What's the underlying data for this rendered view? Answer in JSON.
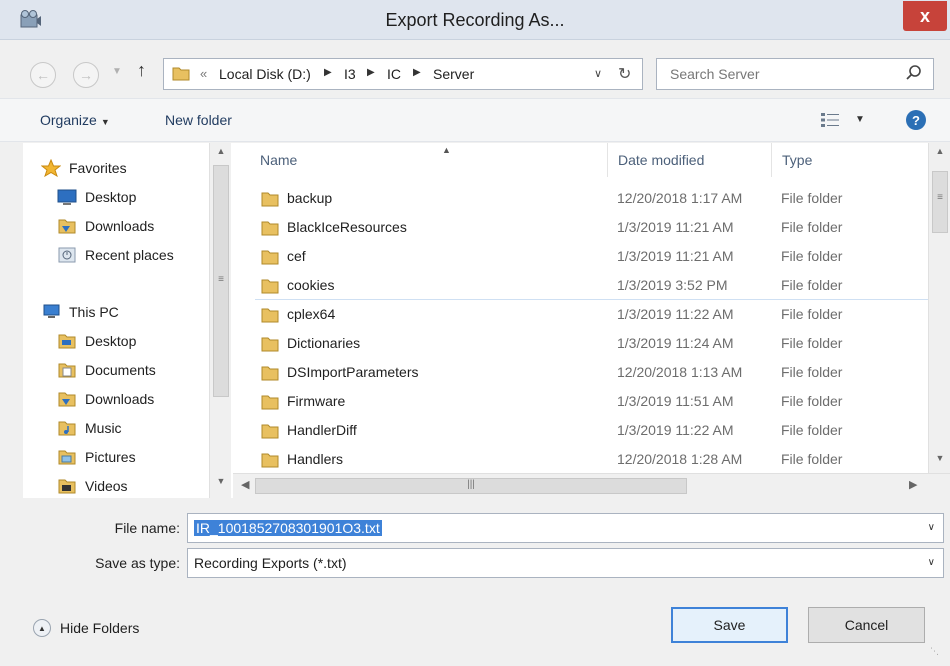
{
  "window": {
    "title": "Export Recording As...",
    "close_label": "x"
  },
  "address_bar": {
    "prefix": "«",
    "crumbs": [
      "Local Disk (D:)",
      "I3",
      "IC",
      "Server"
    ]
  },
  "search": {
    "placeholder": "Search Server"
  },
  "toolbar": {
    "organize_label": "Organize",
    "new_folder_label": "New folder",
    "help_label": "?"
  },
  "nav_pane": {
    "items": [
      {
        "label": "Favorites",
        "icon": "star-icon"
      },
      {
        "label": "Desktop",
        "icon": "desktop-icon"
      },
      {
        "label": "Downloads",
        "icon": "downloads-icon"
      },
      {
        "label": "Recent places",
        "icon": "recent-places-icon"
      },
      {
        "label": "This PC",
        "icon": "computer-icon"
      },
      {
        "label": "Desktop",
        "icon": "desktop-folder-icon"
      },
      {
        "label": "Documents",
        "icon": "documents-icon"
      },
      {
        "label": "Downloads",
        "icon": "downloads-icon"
      },
      {
        "label": "Music",
        "icon": "music-icon"
      },
      {
        "label": "Pictures",
        "icon": "pictures-icon"
      },
      {
        "label": "Videos",
        "icon": "videos-icon"
      }
    ]
  },
  "file_list": {
    "columns": [
      "Name",
      "Date modified",
      "Type"
    ],
    "rows": [
      {
        "name": "backup",
        "date": "12/20/2018 1:17 AM",
        "type": "File folder"
      },
      {
        "name": "BlackIceResources",
        "date": "1/3/2019 11:21 AM",
        "type": "File folder"
      },
      {
        "name": "cef",
        "date": "1/3/2019 11:21 AM",
        "type": "File folder"
      },
      {
        "name": "cookies",
        "date": "1/3/2019 3:52 PM",
        "type": "File folder"
      },
      {
        "name": "cplex64",
        "date": "1/3/2019 11:22 AM",
        "type": "File folder"
      },
      {
        "name": "Dictionaries",
        "date": "1/3/2019 11:24 AM",
        "type": "File folder"
      },
      {
        "name": "DSImportParameters",
        "date": "12/20/2018 1:13 AM",
        "type": "File folder"
      },
      {
        "name": "Firmware",
        "date": "1/3/2019 11:51 AM",
        "type": "File folder"
      },
      {
        "name": "HandlerDiff",
        "date": "1/3/2019 11:22 AM",
        "type": "File folder"
      },
      {
        "name": "Handlers",
        "date": "12/20/2018 1:28 AM",
        "type": "File folder"
      }
    ]
  },
  "fields": {
    "file_name_label": "File name:",
    "file_name_value": "IR_1001852708301901O3.txt",
    "save_type_label": "Save as type:",
    "save_type_value": "Recording Exports (*.txt)"
  },
  "footer": {
    "hide_folders_label": "Hide Folders",
    "save_label": "Save",
    "cancel_label": "Cancel"
  },
  "colors": {
    "title_bar": "#dfe5ee",
    "close_button": "#c7433a",
    "selection": "#3e82d8",
    "folder": "#e8c060"
  }
}
